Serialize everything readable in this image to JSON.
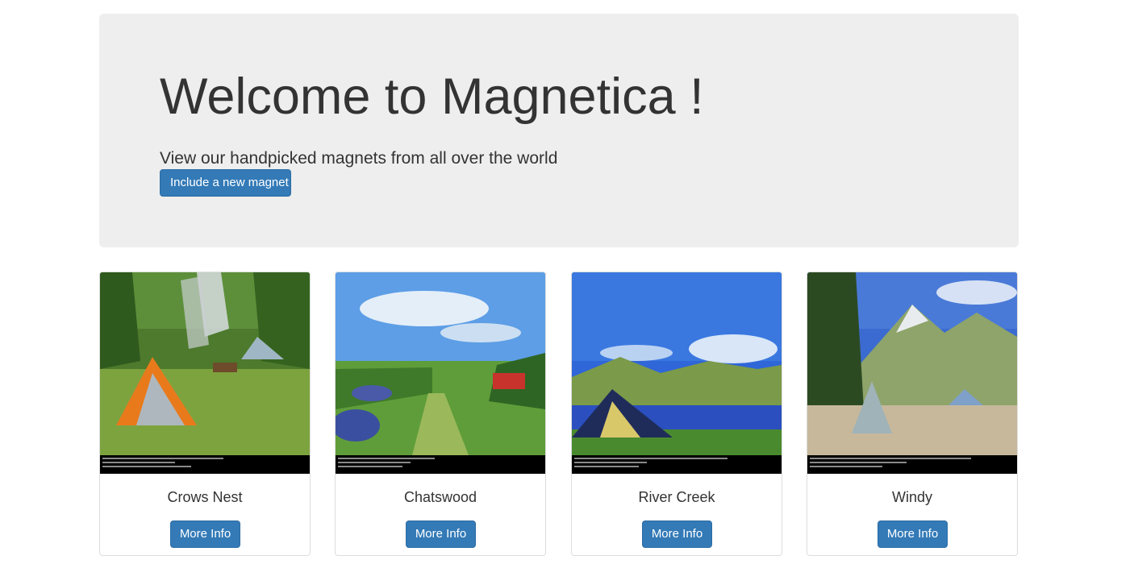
{
  "hero": {
    "title": "Welcome to Magnetica !",
    "subtitle": "View our handpicked magnets from all over the world",
    "button_label": "Include a new magnet"
  },
  "cards": [
    {
      "name": "Crows Nest",
      "button_label": "More Info"
    },
    {
      "name": "Chatswood",
      "button_label": "More Info"
    },
    {
      "name": "River Creek",
      "button_label": "More Info"
    },
    {
      "name": "Windy",
      "button_label": "More Info"
    }
  ],
  "colors": {
    "primary_button": "#337ab7",
    "jumbotron_bg": "#eeeeee",
    "text": "#333333"
  }
}
